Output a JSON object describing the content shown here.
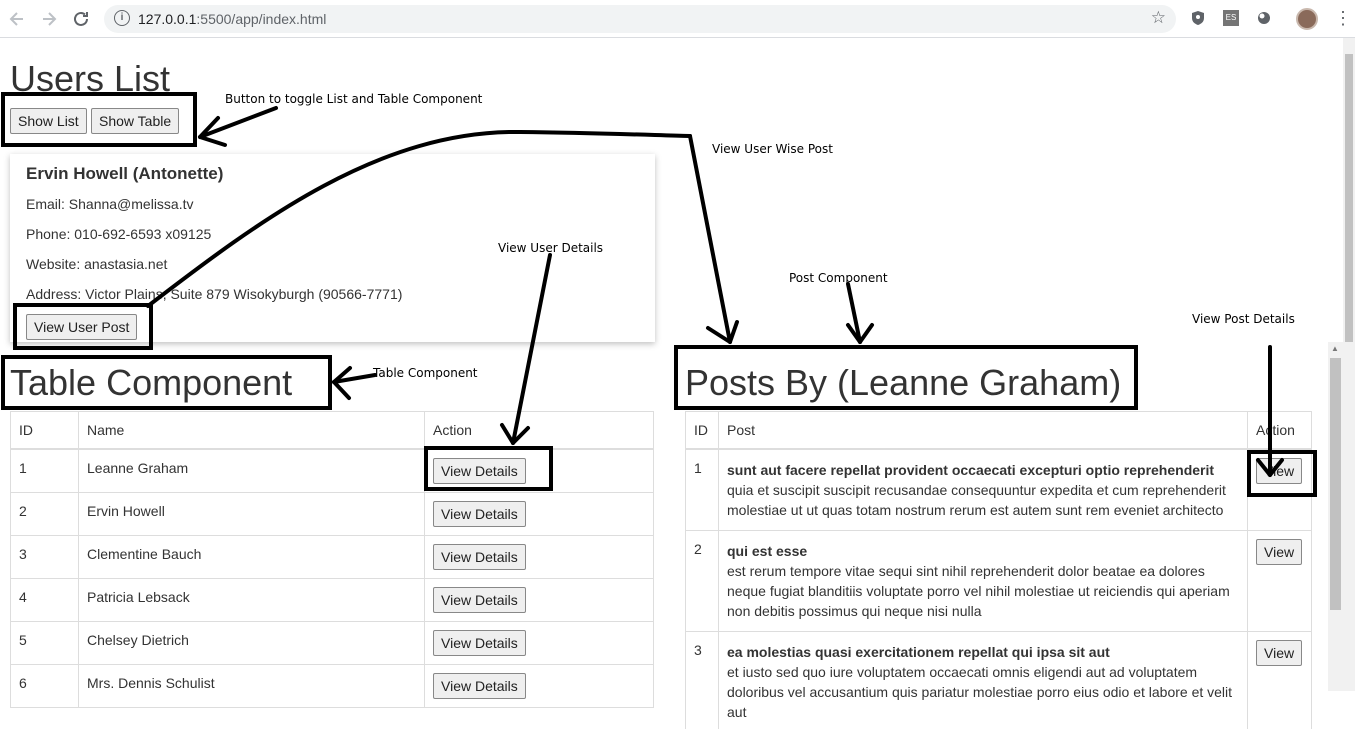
{
  "browser": {
    "url_host": "127.0.0.1",
    "url_rest": ":5500/app/index.html",
    "back_icon": "arrow-left-icon",
    "forward_icon": "arrow-right-icon",
    "reload_icon": "reload-icon",
    "ext_badge": "ES"
  },
  "page": {
    "title": "Users List",
    "show_list_label": "Show List",
    "show_table_label": "Show Table"
  },
  "user_card": {
    "name": "Ervin Howell (Antonette)",
    "email": "Email: Shanna@melissa.tv",
    "phone": "Phone: 010-692-6593 x09125",
    "website": "Website: anastasia.net",
    "address": "Address: Victor Plains, Suite 879 Wisokyburgh (90566-7771)",
    "view_post_label": "View User Post"
  },
  "users_table": {
    "title": "Table Component",
    "headers": [
      "ID",
      "Name",
      "Action"
    ],
    "action_label": "View Details",
    "rows": [
      {
        "id": "1",
        "name": "Leanne Graham"
      },
      {
        "id": "2",
        "name": "Ervin Howell"
      },
      {
        "id": "3",
        "name": "Clementine Bauch"
      },
      {
        "id": "4",
        "name": "Patricia Lebsack"
      },
      {
        "id": "5",
        "name": "Chelsey Dietrich"
      },
      {
        "id": "6",
        "name": "Mrs. Dennis Schulist"
      }
    ]
  },
  "posts_table": {
    "title": "Posts By (Leanne Graham)",
    "headers": [
      "ID",
      "Post",
      "Action"
    ],
    "action_label": "View",
    "rows": [
      {
        "id": "1",
        "title": "sunt aut facere repellat provident occaecati excepturi optio reprehenderit",
        "body": "quia et suscipit suscipit recusandae consequuntur expedita et cum reprehenderit molestiae ut ut quas totam nostrum rerum est autem sunt rem eveniet architecto"
      },
      {
        "id": "2",
        "title": "qui est esse",
        "body": "est rerum tempore vitae sequi sint nihil reprehenderit dolor beatae ea dolores neque fugiat blanditiis voluptate porro vel nihil molestiae ut reiciendis qui aperiam non debitis possimus qui neque nisi nulla"
      },
      {
        "id": "3",
        "title": "ea molestias quasi exercitationem repellat qui ipsa sit aut",
        "body": "et iusto sed quo iure voluptatem occaecati omnis eligendi aut ad voluptatem doloribus vel accusantium quis pariatur molestiae porro eius odio et labore et velit aut"
      }
    ]
  },
  "annotations": {
    "toggle": "Button to toggle List and Table Component",
    "user_wise_post": "View User Wise Post",
    "user_details": "View User Details",
    "post_component": "Post Component",
    "table_component": "Table Component",
    "post_details": "View Post Details"
  }
}
